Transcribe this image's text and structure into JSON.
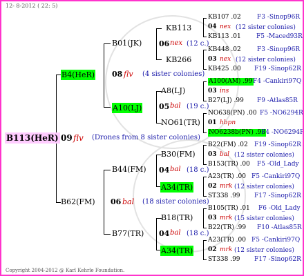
{
  "date": "12- 8-2012 ( 22: 5)",
  "footer": "Copyright 2004-2012 @ Karl Kehrle Foundation.",
  "colors": {
    "border": "#ff33cc",
    "green": "#00ff00",
    "pink": "#ffccff",
    "blue": "#1a1aaa",
    "red": "#cc0000"
  },
  "root": {
    "id": "B113(HeR)",
    "year": "09",
    "race": "flv",
    "note": "(Drones from 8 sister colonies)"
  },
  "gen1": {
    "top": {
      "id": "B4(HeR)"
    },
    "bottom": {
      "id": "B62(FM)"
    }
  },
  "gen2": {
    "b01": {
      "id": "B01(JK)",
      "year": "08",
      "race": "flv",
      "note": "(4 sister colonies)"
    },
    "a10": {
      "id": "A10(LJ)"
    },
    "b44": {
      "id": "B44(FM)",
      "year": "06",
      "race": "bal",
      "note": "(18 sister colonies)"
    },
    "b77": {
      "id": "B77(TR)"
    }
  },
  "gen3": {
    "kb113": {
      "id": "KB113",
      "year": "06",
      "race": "nex",
      "note": "(12 c.)"
    },
    "kb266": {
      "id": "KB266"
    },
    "a8": {
      "id": "A8(LJ)",
      "year": "05",
      "race": "bal",
      "note": "(19 c.)"
    },
    "no61": {
      "id": "NO61(TR)"
    },
    "b30": {
      "id": "B30(FM)",
      "year": "04",
      "race": "bal",
      "note": "(18 c.)"
    },
    "a34a": {
      "id": "A34(TR)"
    },
    "b18": {
      "id": "B18(TR)",
      "year": "04",
      "race": "bal",
      "note": "(18 c.)"
    },
    "a34b": {
      "id": "A34(TR)"
    }
  },
  "gen4": [
    {
      "id": "KB107 .02",
      "ref": "F3 -Sinop96R"
    },
    {
      "year": "04",
      "race": "nex",
      "note": "(12 sister colonies)"
    },
    {
      "id": "KB113 .01",
      "ref": "F5 -Maced93R"
    },
    {
      "id": "KB448 .02",
      "ref": "F3 -Sinop96R"
    },
    {
      "year": "03",
      "race": "nex",
      "note": "(12 sister colonies)"
    },
    {
      "id": "KB425 .00",
      "ref": "F19 -Sinop62R"
    },
    {
      "id": "A100(AM) .99",
      "ref": "F4 -Cankiri97Q"
    },
    {
      "year": "03",
      "race": "ins",
      "note": ""
    },
    {
      "id": "B27(LJ) .99",
      "ref": "F9 -Atlas85R"
    },
    {
      "id": "NO638(PN) .00",
      "ref": "F5 -NO6294R"
    },
    {
      "year": "01",
      "race": "hbpn",
      "note": ""
    },
    {
      "id": "NO6238b(PN) .98",
      "ref": "F4 -NO6294R"
    },
    {
      "id": "B22(FM) .02",
      "ref": "F19 -Sinop62R"
    },
    {
      "year": "03",
      "race": "bal",
      "note": "(12 sister colonies)"
    },
    {
      "id": "B153(TR) .00",
      "ref": "F5 -Old_Lady"
    },
    {
      "id": "A23(TR) .00",
      "ref": "F5 -Cankiri97Q"
    },
    {
      "year": "02",
      "race": "mrk",
      "note": "(12 sister colonies)"
    },
    {
      "id": "ST338 .99",
      "ref": "F17 -Sinop62R"
    },
    {
      "id": "B105(TR) .01",
      "ref": "F6 -Old_Lady"
    },
    {
      "year": "03",
      "race": "mrk",
      "note": "(15 sister colonies)"
    },
    {
      "id": "B22(TR) .99",
      "ref": "F10 -Atlas85R"
    },
    {
      "id": "A23(TR) .00",
      "ref": "F5 -Cankiri97Q"
    },
    {
      "year": "02",
      "race": "mrk",
      "note": "(12 sister colonies)"
    },
    {
      "id": "ST338 .99",
      "ref": "F17 -Sinop62R"
    }
  ]
}
